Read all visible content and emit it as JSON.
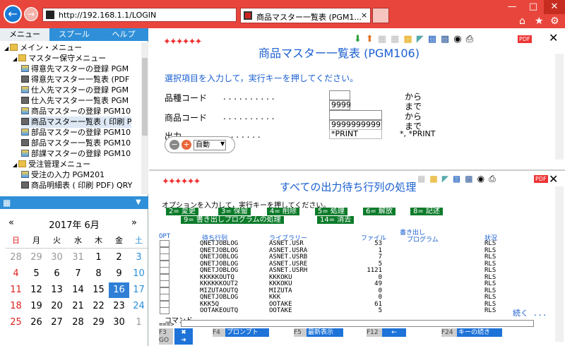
{
  "browser": {
    "address": "http://192.168.1.1/LOGIN",
    "tab_title": "商品マスター一覧表 (PGM1...",
    "tab_close": "×"
  },
  "sidebar": {
    "tabs": [
      "メニュー",
      "スプール",
      "ヘルプ"
    ],
    "tree": [
      {
        "label": "メイン・メニュー",
        "type": "folder",
        "level": 0
      },
      {
        "label": "マスター保守メニュー",
        "type": "folder",
        "level": 1
      },
      {
        "label": "得意先マスターの登録 PGM",
        "type": "report",
        "level": 2
      },
      {
        "label": "得意先マスター一覧表 (PDF",
        "type": "printer",
        "level": 2
      },
      {
        "label": "仕入先マスターの登録 PGM",
        "type": "report",
        "level": 2
      },
      {
        "label": "仕入先マスター一覧表 PGM",
        "type": "printer",
        "level": 2
      },
      {
        "label": "商品マスターの登録 PGM10",
        "type": "report",
        "level": 2
      },
      {
        "label": "商品マスター一覧表 ( 印刷 P",
        "type": "printer",
        "level": 2
      },
      {
        "label": "部品マスターの登録 PGM10",
        "type": "report",
        "level": 2
      },
      {
        "label": "部品マスター一覧表 PGM10",
        "type": "printer",
        "level": 2
      },
      {
        "label": "部課マスターの登録 PGM10",
        "type": "report",
        "level": 2
      },
      {
        "label": "受注管理メニュー",
        "type": "folder",
        "level": 1
      },
      {
        "label": "受注の入力 PGM201",
        "type": "report",
        "level": 2
      },
      {
        "label": "商品明細表 ( 印刷 PDF) QRY",
        "type": "printer",
        "level": 2
      }
    ]
  },
  "calendar": {
    "prev": "«",
    "next": "»",
    "title": "2017年 6月",
    "weekdays": [
      "日",
      "月",
      "火",
      "水",
      "木",
      "金",
      "土"
    ],
    "weeks": [
      [
        "28",
        "29",
        "30",
        "31",
        "1",
        "2",
        "3"
      ],
      [
        "4",
        "5",
        "6",
        "7",
        "8",
        "9",
        "10"
      ],
      [
        "11",
        "12",
        "13",
        "14",
        "15",
        "16",
        "17"
      ],
      [
        "18",
        "19",
        "20",
        "21",
        "22",
        "23",
        "24"
      ],
      [
        "25",
        "26",
        "27",
        "28",
        "29",
        "30",
        "1"
      ]
    ],
    "selected": "16"
  },
  "pane1": {
    "title": "商品マスター一覧表 (PGM106)",
    "instruction": "選択項目を入力して，実行キーを押してください。",
    "rows": [
      {
        "label": "品種コード",
        "dots": ". . . . . . . . . .",
        "value1": "",
        "value2": "9999",
        "kara": "から",
        "made": "まで"
      },
      {
        "label": "商品コード",
        "dots": ". . . . . . . . . .",
        "value1": "",
        "value2": "9999999999",
        "kara": "から",
        "made": "まで"
      },
      {
        "label": "出力",
        "dots": ". . . . . . . . . . . .",
        "value1": "*PRINT",
        "note": "*, *PRINT"
      }
    ],
    "zoom_label": "自動",
    "pdf_label": "PDF"
  },
  "pane2": {
    "title": "すべての出力待ち行列の処理",
    "instruction": "オプションを入力して，実行キーを押してください。",
    "options": [
      "2= 変更",
      "3= 保留",
      "4= 削除",
      "5= 処理",
      "6= 解放",
      "8= 記述",
      "9= 書き出しプログラムの処理",
      "14= 消去"
    ],
    "header": {
      "opt": "OPT",
      "queue": "待ち行列",
      "library": "ライブラリー",
      "files": "ファイル",
      "writer_top": "書き出し",
      "writer": "プログラム",
      "status": "状況"
    },
    "rows": [
      {
        "queue": "QNETJOBLOG",
        "library": "ASNET.USR",
        "files": "53",
        "status": "RLS"
      },
      {
        "queue": "QNETJOBLOG",
        "library": "ASNET.USRA",
        "files": "1",
        "status": "RLS"
      },
      {
        "queue": "QNETJOBLOG",
        "library": "ASNET.USRB",
        "files": "7",
        "status": "RLS"
      },
      {
        "queue": "QNETJOBLOG",
        "library": "ASNET.USRE",
        "files": "5",
        "status": "RLS"
      },
      {
        "queue": "QNETJOBLOG",
        "library": "ASNET.USRH",
        "files": "1121",
        "status": "RLS"
      },
      {
        "queue": "KKKKKOUTQ",
        "library": "KKKOKU",
        "files": "0",
        "status": "RLS"
      },
      {
        "queue": "KKKKKKOUT2",
        "library": "KKKOKU",
        "files": "49",
        "status": "RLS"
      },
      {
        "queue": "MIZUTAOUTQ",
        "library": "MIZUTA",
        "files": "0",
        "status": "RLS"
      },
      {
        "queue": "QNETJOBLOG",
        "library": "KKK",
        "files": "0",
        "status": "RLS"
      },
      {
        "queue": "KKK5Q",
        "library": "OOTAKE",
        "files": "61",
        "status": "RLS"
      },
      {
        "queue": "OOTAKEOUTQ",
        "library": "OOTAKE",
        "files": "5",
        "status": "RLS"
      }
    ],
    "more": "続く ...",
    "command_label": "コマンド",
    "command_prompt": "===>",
    "fkeys": [
      {
        "key": "F3",
        "label": ""
      },
      {
        "key": "F4",
        "label": "プロンプト"
      },
      {
        "key": "F5",
        "label": "最新表示"
      },
      {
        "key": "F12",
        "label": ""
      },
      {
        "key": "F24",
        "label": "キーの続き"
      },
      {
        "key": "GO",
        "label": ""
      }
    ]
  },
  "colors": {
    "browser": "#e8463c",
    "accent": "#2f8fd8",
    "title_blue": "#1a5fd0",
    "green": "#0c7b2a"
  }
}
